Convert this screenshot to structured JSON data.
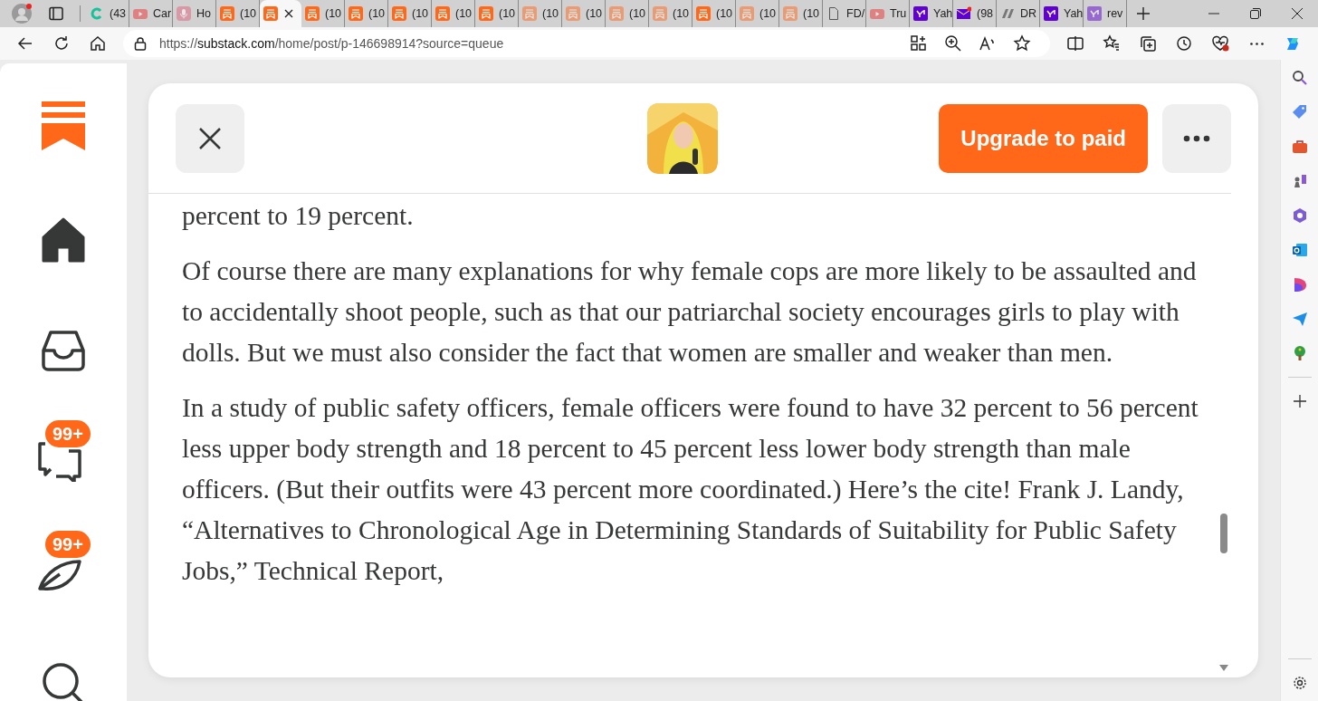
{
  "browser": {
    "tabs": [
      {
        "kind": "grammarly",
        "title": "(43",
        "selected": false,
        "dimmed": false
      },
      {
        "kind": "youtube",
        "title": "Car",
        "selected": false,
        "dimmed": true
      },
      {
        "kind": "podcast",
        "title": "Ho",
        "selected": false,
        "dimmed": true
      },
      {
        "kind": "substack",
        "title": "(10",
        "selected": false,
        "dimmed": false
      },
      {
        "kind": "substack",
        "selected": true,
        "dimmed": false
      },
      {
        "kind": "substack",
        "title": "(10",
        "selected": false,
        "dimmed": false
      },
      {
        "kind": "substack",
        "title": "(10",
        "selected": false,
        "dimmed": false
      },
      {
        "kind": "substack",
        "title": "(10",
        "selected": false,
        "dimmed": false
      },
      {
        "kind": "substack",
        "title": "(10",
        "selected": false,
        "dimmed": false
      },
      {
        "kind": "substack",
        "title": "(10",
        "selected": false,
        "dimmed": false
      },
      {
        "kind": "substack",
        "title": "(10",
        "selected": false,
        "dimmed": true
      },
      {
        "kind": "substack",
        "title": "(10",
        "selected": false,
        "dimmed": true
      },
      {
        "kind": "substack",
        "title": "(10",
        "selected": false,
        "dimmed": true
      },
      {
        "kind": "substack",
        "title": "(10",
        "selected": false,
        "dimmed": true
      },
      {
        "kind": "substack",
        "title": "(10",
        "selected": false,
        "dimmed": false
      },
      {
        "kind": "substack",
        "title": "(10",
        "selected": false,
        "dimmed": true
      },
      {
        "kind": "substack",
        "title": "(10",
        "selected": false,
        "dimmed": true
      },
      {
        "kind": "document",
        "title": "FD/",
        "selected": false,
        "dimmed": false
      },
      {
        "kind": "youtube",
        "title": "Tru",
        "selected": false,
        "dimmed": true
      },
      {
        "kind": "yahoo",
        "title": "Yah",
        "selected": false,
        "dimmed": false
      },
      {
        "kind": "mail",
        "title": "(98",
        "selected": false,
        "dimmed": false
      },
      {
        "kind": "slashes",
        "title": "DR",
        "selected": false,
        "dimmed": false
      },
      {
        "kind": "yahoo",
        "title": "Yah",
        "selected": false,
        "dimmed": false
      },
      {
        "kind": "yahoo",
        "title": "rev",
        "selected": false,
        "dimmed": true
      }
    ],
    "address": {
      "scheme": "https://",
      "domain": "substack.com",
      "path": "/home/post/p-146698914?source=queue"
    }
  },
  "sidebar": {
    "items": [
      {
        "kind": "home"
      },
      {
        "kind": "inbox"
      },
      {
        "kind": "chat",
        "badge": "99+"
      },
      {
        "kind": "activity",
        "badge": "99+"
      },
      {
        "kind": "search"
      }
    ]
  },
  "header": {
    "upgrade_button": "Upgrade to paid"
  },
  "article": {
    "paragraphs": [
      "percent to 19 percent.",
      "Of course there are many explanations for why female cops are more likely to be assaulted and to accidentally shoot people, such as that our patriarchal society encourages girls to play with dolls. But we must also consider the fact that women are smaller and weaker than men.",
      "In a study of public safety officers, female officers were found to have 32 percent to 56 percent less upper body strength and 18 percent to 45 percent less lower body strength than male officers. (But their outfits were 43 percent more coordinated.) Here’s the cite! Frank J. Landy, “Alternatives to Chronological Age in Determining Standards of Suitability for Public Safety Jobs,” Technical Report,"
    ]
  }
}
